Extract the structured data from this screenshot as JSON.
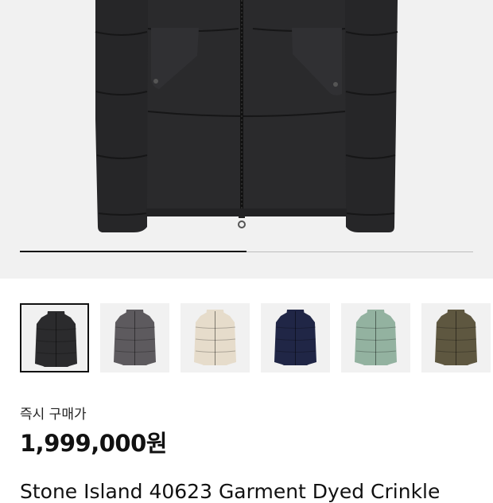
{
  "gallery": {
    "hero_image": "down-jacket-black",
    "progress": 0.5,
    "thumbnails": [
      {
        "name": "thumb-black",
        "color": "#2b2b2d",
        "selected": true
      },
      {
        "name": "thumb-grey",
        "color": "#5d5a5e",
        "selected": false
      },
      {
        "name": "thumb-cream",
        "color": "#e6dccb",
        "selected": false
      },
      {
        "name": "thumb-navy",
        "color": "#202646",
        "selected": false
      },
      {
        "name": "thumb-mint",
        "color": "#93b2a0",
        "selected": false
      },
      {
        "name": "thumb-olive",
        "color": "#5e5740",
        "selected": false
      }
    ]
  },
  "price": {
    "label": "즉시 구매가",
    "value": "1,999,000원"
  },
  "product": {
    "name": "Stone Island 40623 Garment Dyed Crinkle"
  }
}
